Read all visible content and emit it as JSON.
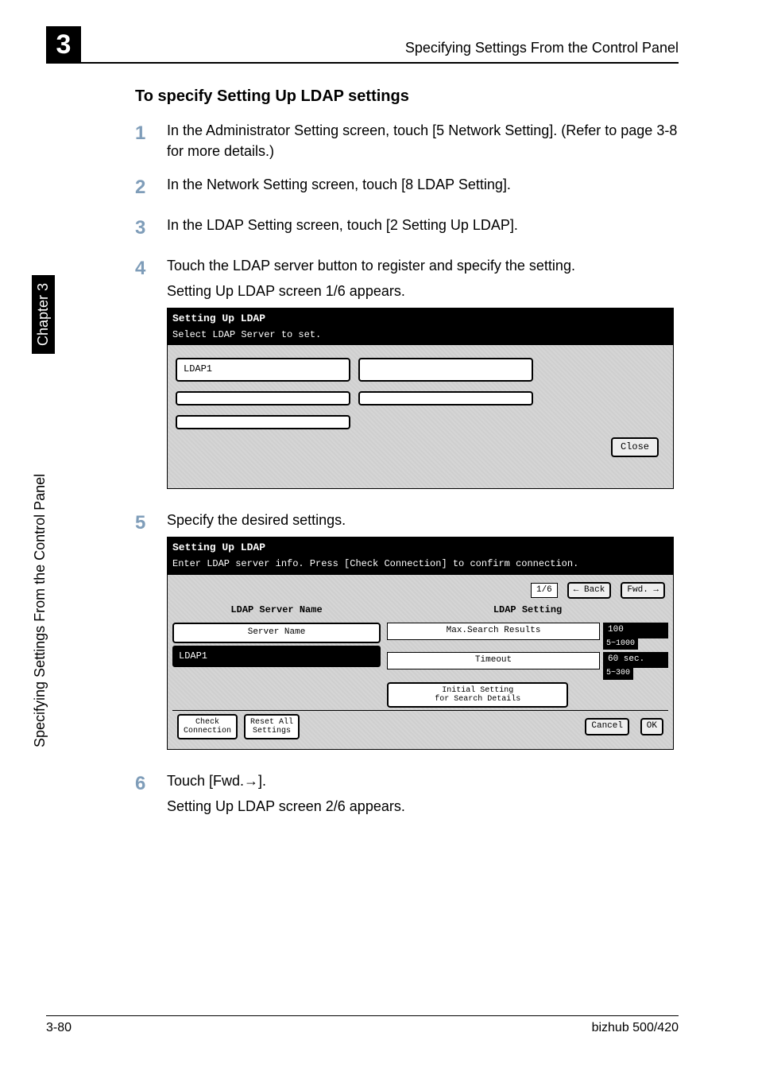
{
  "chapter_number": "3",
  "header_right": "Specifying Settings From the Control Panel",
  "side_label_main": "Specifying Settings From the Control Panel",
  "side_label_chapter": "Chapter 3",
  "section_title": "To specify Setting Up LDAP settings",
  "steps": {
    "s1": {
      "num": "1",
      "text": "In the Administrator Setting screen, touch [5 Network Setting]. (Refer to page 3-8 for more details.)"
    },
    "s2": {
      "num": "2",
      "text": "In the Network Setting screen, touch [8 LDAP Setting]."
    },
    "s3": {
      "num": "3",
      "text": "In the LDAP Setting screen, touch [2 Setting Up LDAP]."
    },
    "s4": {
      "num": "4",
      "text": "Touch the LDAP server button to register and specify the setting.",
      "sub": "Setting Up LDAP screen 1/6 appears."
    },
    "s5": {
      "num": "5",
      "text": "Specify the desired settings."
    },
    "s6": {
      "num": "6",
      "text": "Touch [Fwd.→].",
      "sub": "Setting Up LDAP screen 2/6 appears."
    }
  },
  "lcd1": {
    "title": "Setting Up LDAP",
    "subtitle": "Select LDAP Server to set.",
    "server1": "LDAP1",
    "close": "Close"
  },
  "lcd2": {
    "title": "Setting Up LDAP",
    "subtitle": "Enter LDAP server info. Press [Check Connection] to confirm connection.",
    "page": "1/6",
    "back": "← Back",
    "fwd": "Fwd. →",
    "left_header": "LDAP Server Name",
    "right_header": "LDAP Setting",
    "server_name_label": "Server Name",
    "server_name_value": "LDAP1",
    "max_label": "Max.Search Results",
    "max_value": "100",
    "max_range": "5~1000",
    "timeout_label": "Timeout",
    "timeout_value": "60 sec.",
    "timeout_range": "5~300",
    "initial_label": "Initial Setting\nfor Search Details",
    "check_conn": "Check\nConnection",
    "reset_all": "Reset All\nSettings",
    "cancel": "Cancel",
    "ok": "OK"
  },
  "footer_left": "3-80",
  "footer_right": "bizhub 500/420"
}
